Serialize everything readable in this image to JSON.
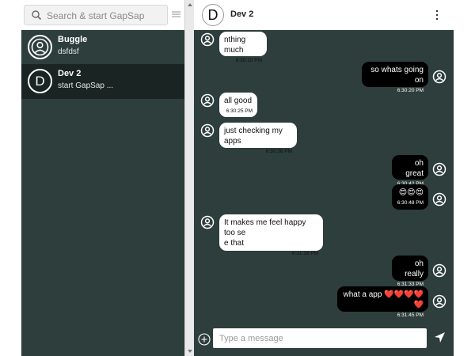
{
  "sidebar": {
    "search_placeholder": "Search & start GapSap",
    "chats": [
      {
        "name": "Buggle",
        "preview": "dsfdsf",
        "avatar": "person-icon"
      },
      {
        "name": "Dev 2",
        "preview": "start GapSap ...",
        "avatar_letter": "D"
      }
    ]
  },
  "header": {
    "avatar_letter": "D",
    "name": "Dev 2"
  },
  "messages": [
    {
      "direction": "in",
      "text": "nthing much",
      "time": "6:30:10 PM"
    },
    {
      "direction": "out",
      "text": "so whats going on",
      "time": "6:30:20 PM"
    },
    {
      "direction": "in",
      "text": "all good",
      "time": "6:30:25 PM"
    },
    {
      "direction": "in",
      "text": "just checking my apps",
      "time": "6:30:36 PM"
    },
    {
      "direction": "out",
      "text": "oh great",
      "time": "6:30:42 PM"
    },
    {
      "direction": "out",
      "text": "😍😍😍",
      "time": "6:30:48 PM"
    },
    {
      "direction": "in",
      "text": "It makes me feel happy too se\ne that",
      "time": "6:31:28 PM"
    },
    {
      "direction": "out",
      "text": "oh really",
      "time": "6:31:33 PM"
    },
    {
      "direction": "out",
      "text": "what a app ❤️❤️❤️❤️❤️",
      "time": "6:31:45 PM"
    }
  ],
  "composer": {
    "placeholder": "Type a message"
  },
  "colors": {
    "panel_bg": "#2d3e3c",
    "selected_chat_bg": "#1a2422",
    "incoming_bubble": "#ffffff",
    "outgoing_bubble": "#000000"
  }
}
